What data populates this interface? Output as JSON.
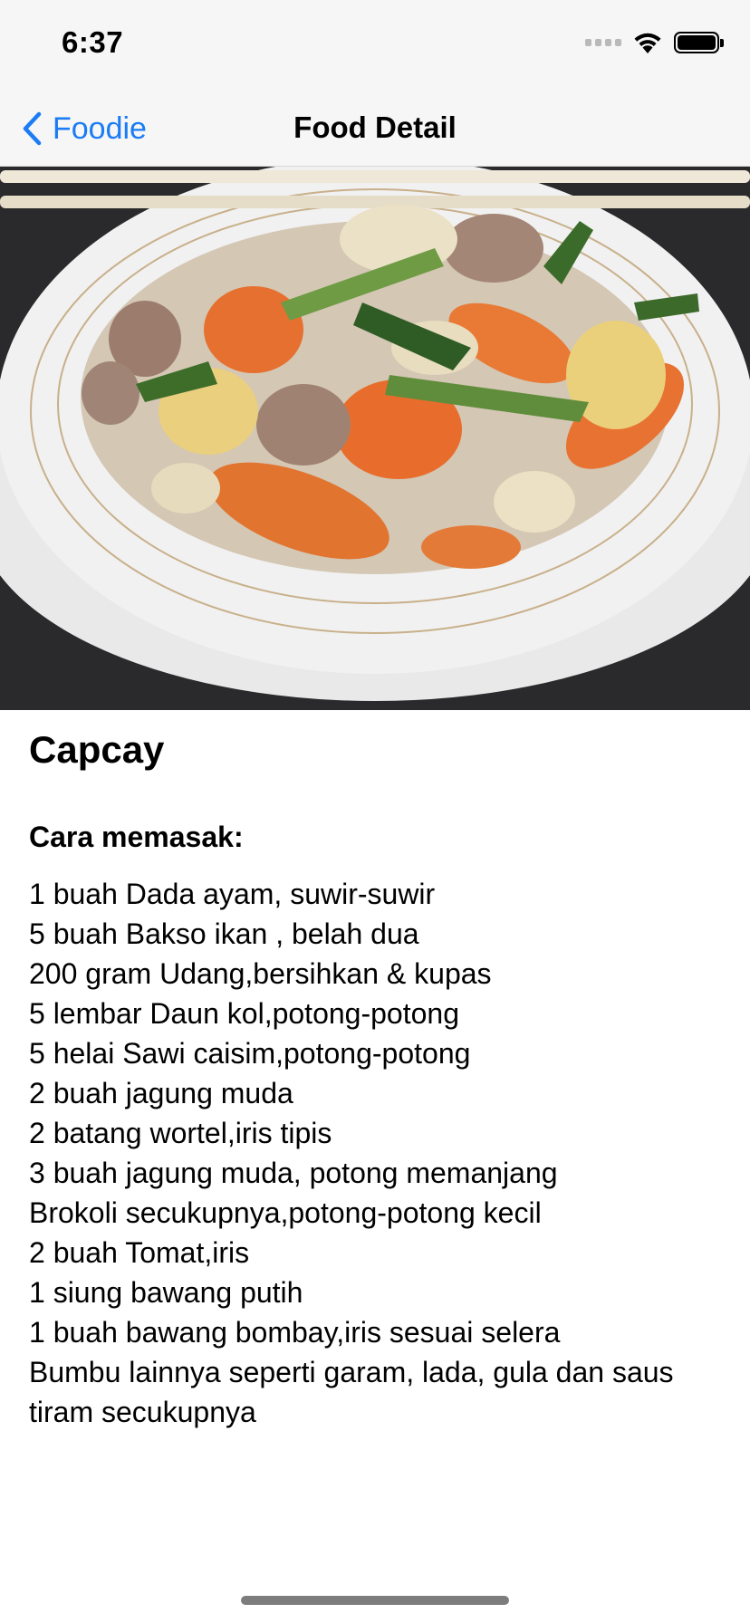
{
  "status_bar": {
    "time": "6:37",
    "icons": [
      "signal-icon",
      "wifi-icon",
      "battery-icon"
    ]
  },
  "nav": {
    "back_label": "Foodie",
    "title": "Food Detail",
    "accent_color": "#1b7cf5"
  },
  "food": {
    "name": "Capcay",
    "section_title": "Cara memasak:",
    "ingredients": [
      "1 buah Dada ayam, suwir-suwir",
      "5 buah Bakso ikan , belah dua",
      "200 gram Udang,bersihkan & kupas",
      "5 lembar Daun kol,potong-potong",
      "5 helai Sawi caisim,potong-potong",
      "2 buah jagung muda",
      "2 batang wortel,iris tipis",
      "3 buah jagung muda, potong memanjang",
      "Brokoli secukupnya,potong-potong kecil",
      "2 buah Tomat,iris",
      "1 siung bawang putih",
      "1 buah bawang bombay,iris sesuai selera",
      "Bumbu lainnya seperti garam, lada, gula dan saus tiram secukupnya"
    ]
  }
}
